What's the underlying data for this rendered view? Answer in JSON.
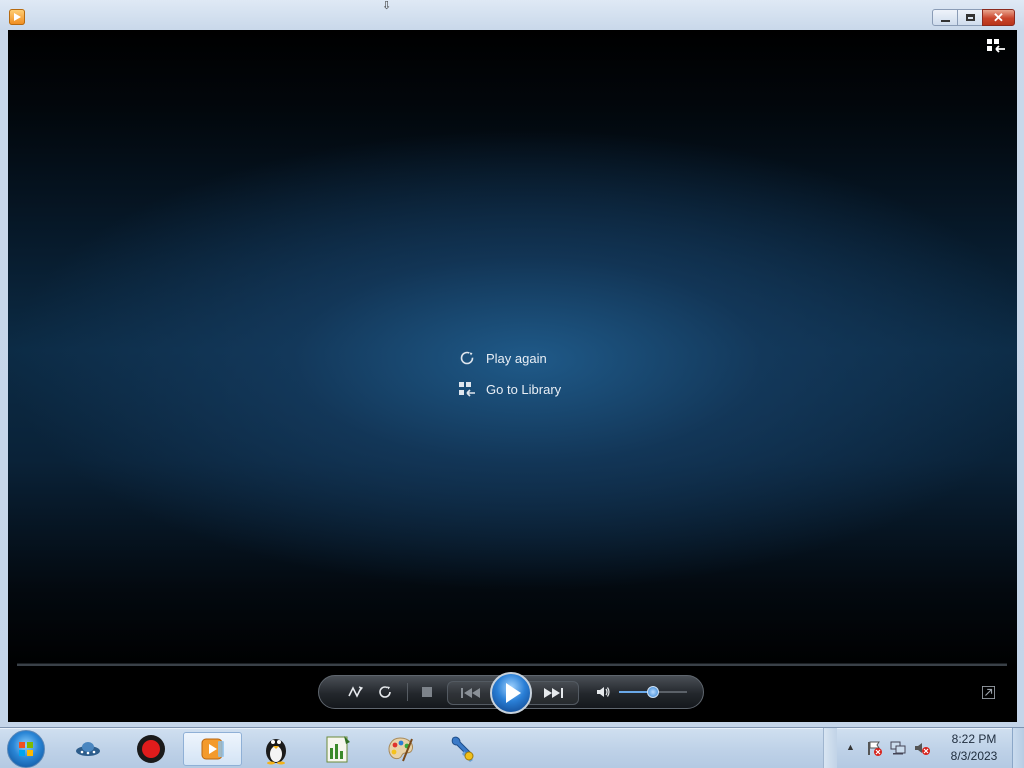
{
  "window": {
    "minimize_label": "minimize",
    "maximize_label": "maximize",
    "close_label": "✕"
  },
  "overlay": {
    "play_again": "Play again",
    "go_to_library": "Go to Library"
  },
  "controls": {
    "volume_level": 0.5,
    "shuffle_icon": "shuffle-icon",
    "repeat_icon": "repeat-icon",
    "stop_icon": "stop-icon",
    "previous_icon": "previous-icon",
    "play_icon": "play-icon",
    "next_icon": "next-icon",
    "mute_icon": "speaker-icon",
    "fullscreen_icon": "switch-to-now-playing-icon"
  },
  "taskbar": {
    "items": [
      {
        "name": "taskbar-item-network-tool",
        "icon": "ufo-icon"
      },
      {
        "name": "taskbar-item-recorder",
        "icon": "record-icon"
      },
      {
        "name": "taskbar-item-media-player",
        "icon": "media-player-icon",
        "active": true
      },
      {
        "name": "taskbar-item-penguin-app",
        "icon": "penguin-icon"
      },
      {
        "name": "taskbar-item-chart-editor",
        "icon": "chart-document-icon"
      },
      {
        "name": "taskbar-item-paint",
        "icon": "palette-icon"
      },
      {
        "name": "taskbar-item-tools",
        "icon": "wrench-icon"
      }
    ],
    "clock_time": "8:22 PM",
    "clock_date": "8/3/2023"
  },
  "colors": {
    "accent": "#2a7fd6",
    "close_button": "#c9452c",
    "taskbar": "#bfd2e8"
  }
}
